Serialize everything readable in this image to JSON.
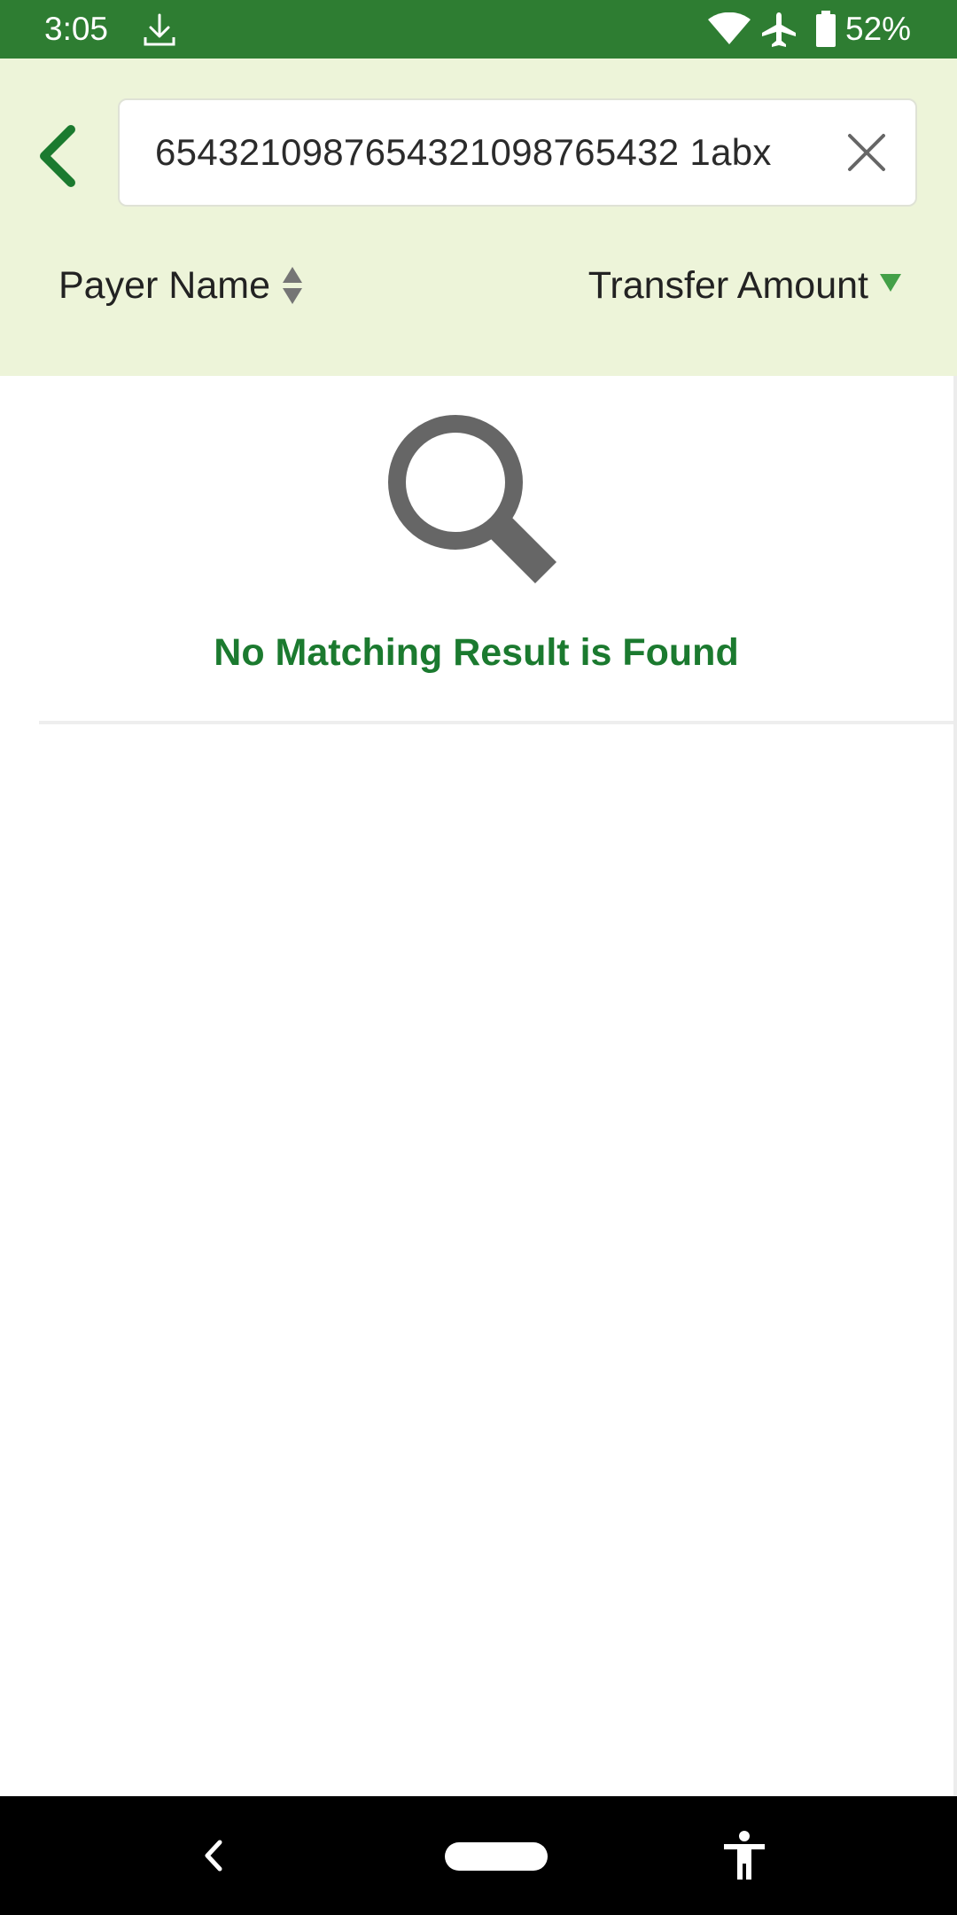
{
  "status_bar": {
    "time": "3:05",
    "battery": "52%",
    "icons": [
      "download-icon",
      "wifi-icon",
      "airplane-icon",
      "battery-icon"
    ]
  },
  "search": {
    "value": "6543210987654321098765432 1abx"
  },
  "sort": {
    "payer_name_label": "Payer Name",
    "transfer_amount_label": "Transfer Amount",
    "active_sort": "Transfer Amount",
    "active_direction": "descending"
  },
  "empty_state": {
    "icon": "search-icon",
    "message": "No Matching Result is Found"
  },
  "colors": {
    "status_bar": "#2e7d32",
    "header_background": "#edf4d9",
    "accent_green": "#1b7a2f",
    "sort_active_arrow": "#43a047",
    "icon_grey": "#666666"
  }
}
